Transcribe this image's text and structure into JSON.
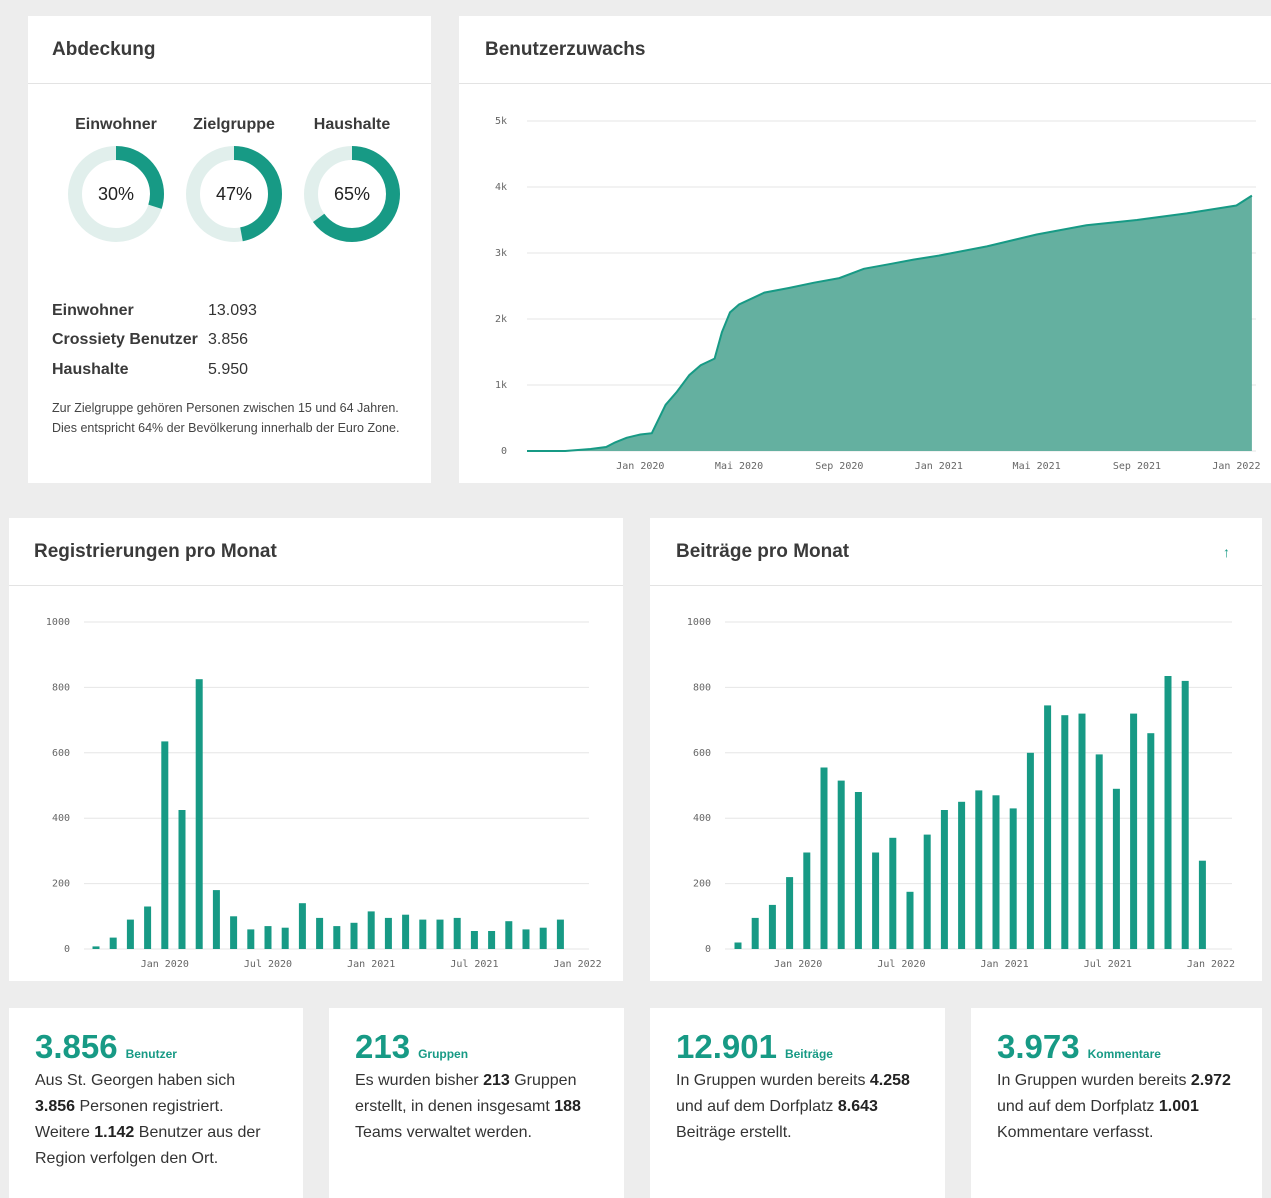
{
  "coverage": {
    "title": "Abdeckung",
    "donuts": [
      {
        "label": "Einwohner",
        "percent": 30,
        "text": "30%"
      },
      {
        "label": "Zielgruppe",
        "percent": 47,
        "text": "47%"
      },
      {
        "label": "Haushalte",
        "percent": 65,
        "text": "65%"
      }
    ],
    "stats": [
      {
        "key": "Einwohner",
        "value": "13.093"
      },
      {
        "key": "Crossiety Benutzer",
        "value": "3.856"
      },
      {
        "key": "Haushalte",
        "value": "5.950"
      }
    ],
    "note": "Zur Zielgruppe gehören Personen zwischen 15 und 64 Jahren. Dies entspricht 64% der Bevölkerung innerhalb der Euro Zone."
  },
  "growth": {
    "title": "Benutzerzuwachs"
  },
  "registrations": {
    "title": "Registrierungen pro Monat"
  },
  "posts": {
    "title": "Beiträge pro Monat",
    "arrow": "↑"
  },
  "colors": {
    "accent": "#179a85",
    "area": "#64b0a0",
    "track": "#e1efec"
  },
  "chart_data": [
    {
      "type": "area",
      "title": "Benutzerzuwachs",
      "x_ticks": [
        "Jan 2020",
        "Mai 2020",
        "Sep 2020",
        "Jan 2021",
        "Mai 2021",
        "Sep 2021",
        "Jan 2022"
      ],
      "x": [
        "2019-08-15",
        "2019-10-01",
        "2019-11-01",
        "2019-11-20",
        "2019-12-01",
        "2019-12-15",
        "2020-01-01",
        "2020-01-15",
        "2020-02-01",
        "2020-02-15",
        "2020-03-01",
        "2020-03-15",
        "2020-04-01",
        "2020-04-10",
        "2020-04-20",
        "2020-05-01",
        "2020-06-01",
        "2020-07-01",
        "2020-08-01",
        "2020-09-01",
        "2020-10-01",
        "2020-11-01",
        "2020-12-01",
        "2021-01-01",
        "2021-03-01",
        "2021-05-01",
        "2021-07-01",
        "2021-09-01",
        "2021-11-01",
        "2022-01-01",
        "2022-01-20"
      ],
      "y": [
        0,
        0,
        30,
        60,
        130,
        200,
        250,
        270,
        700,
        900,
        1150,
        1300,
        1400,
        1800,
        2100,
        2220,
        2400,
        2470,
        2550,
        2620,
        2760,
        2830,
        2900,
        2960,
        3100,
        3280,
        3420,
        3500,
        3600,
        3720,
        3870
      ],
      "ylim": [
        0,
        5000
      ],
      "y_ticks": [
        "0",
        "1k",
        "2k",
        "3k",
        "4k",
        "5k"
      ],
      "grid": true
    },
    {
      "type": "bar",
      "title": "Registrierungen pro Monat",
      "categories": [
        "2019-10",
        "2019-11",
        "2019-12",
        "2020-01",
        "2020-02",
        "2020-03",
        "2020-04",
        "2020-05",
        "2020-06",
        "2020-07",
        "2020-08",
        "2020-09",
        "2020-10",
        "2020-11",
        "2020-12",
        "2021-01",
        "2021-02",
        "2021-03",
        "2021-04",
        "2021-05",
        "2021-06",
        "2021-07",
        "2021-08",
        "2021-09",
        "2021-10",
        "2021-11",
        "2021-12",
        "2022-01"
      ],
      "values": [
        8,
        35,
        90,
        130,
        635,
        425,
        825,
        180,
        100,
        60,
        70,
        65,
        140,
        95,
        70,
        80,
        115,
        95,
        105,
        90,
        90,
        95,
        55,
        55,
        85,
        60,
        65,
        90
      ],
      "ylim": [
        0,
        1000
      ],
      "y_ticks": [
        "0",
        "200",
        "400",
        "600",
        "800",
        "1000"
      ],
      "x_ticks": [
        "Jan 2020",
        "Jul 2020",
        "Jan 2021",
        "Jul 2021",
        "Jan 2022"
      ],
      "grid": true
    },
    {
      "type": "bar",
      "title": "Beiträge pro Monat",
      "categories": [
        "2019-10",
        "2019-11",
        "2019-12",
        "2020-01",
        "2020-02",
        "2020-03",
        "2020-04",
        "2020-05",
        "2020-06",
        "2020-07",
        "2020-08",
        "2020-09",
        "2020-10",
        "2020-11",
        "2020-12",
        "2021-01",
        "2021-02",
        "2021-03",
        "2021-04",
        "2021-05",
        "2021-06",
        "2021-07",
        "2021-08",
        "2021-09",
        "2021-10",
        "2021-11",
        "2021-12",
        "2022-01",
        "2022-02"
      ],
      "values": [
        20,
        95,
        135,
        220,
        295,
        555,
        515,
        480,
        295,
        340,
        175,
        350,
        425,
        450,
        485,
        470,
        430,
        600,
        745,
        715,
        720,
        595,
        490,
        720,
        660,
        835,
        820,
        270
      ],
      "ylim": [
        0,
        1000
      ],
      "y_ticks": [
        "0",
        "200",
        "400",
        "600",
        "800",
        "1000"
      ],
      "x_ticks": [
        "Jan 2020",
        "Jul 2020",
        "Jan 2021",
        "Jul 2021",
        "Jan 2022"
      ],
      "grid": true
    }
  ],
  "kpis": [
    {
      "value": "3.856",
      "unit": "Benutzer",
      "t1": "Aus St. Georgen haben sich ",
      "b1": "3.856",
      "t2": " Personen registriert. Weitere ",
      "b2": "1.142",
      "t3": " Benutzer aus der Region verfolgen den Ort."
    },
    {
      "value": "213",
      "unit": "Gruppen",
      "t1": "Es wurden bisher ",
      "b1": "213",
      "t2": " Gruppen erstellt, in denen insgesamt ",
      "b2": "188",
      "t3": " Teams verwaltet werden."
    },
    {
      "value": "12.901",
      "unit": "Beiträge",
      "t1": "In Gruppen wurden bereits ",
      "b1": "4.258",
      "t2": " und auf dem Dorfplatz ",
      "b2": "8.643",
      "t3": " Beiträge erstellt."
    },
    {
      "value": "3.973",
      "unit": "Kommentare",
      "t1": "In Gruppen wurden bereits ",
      "b1": "2.972",
      "t2": " und auf dem Dorfplatz ",
      "b2": "1.001",
      "t3": " Kommentare verfasst."
    }
  ]
}
